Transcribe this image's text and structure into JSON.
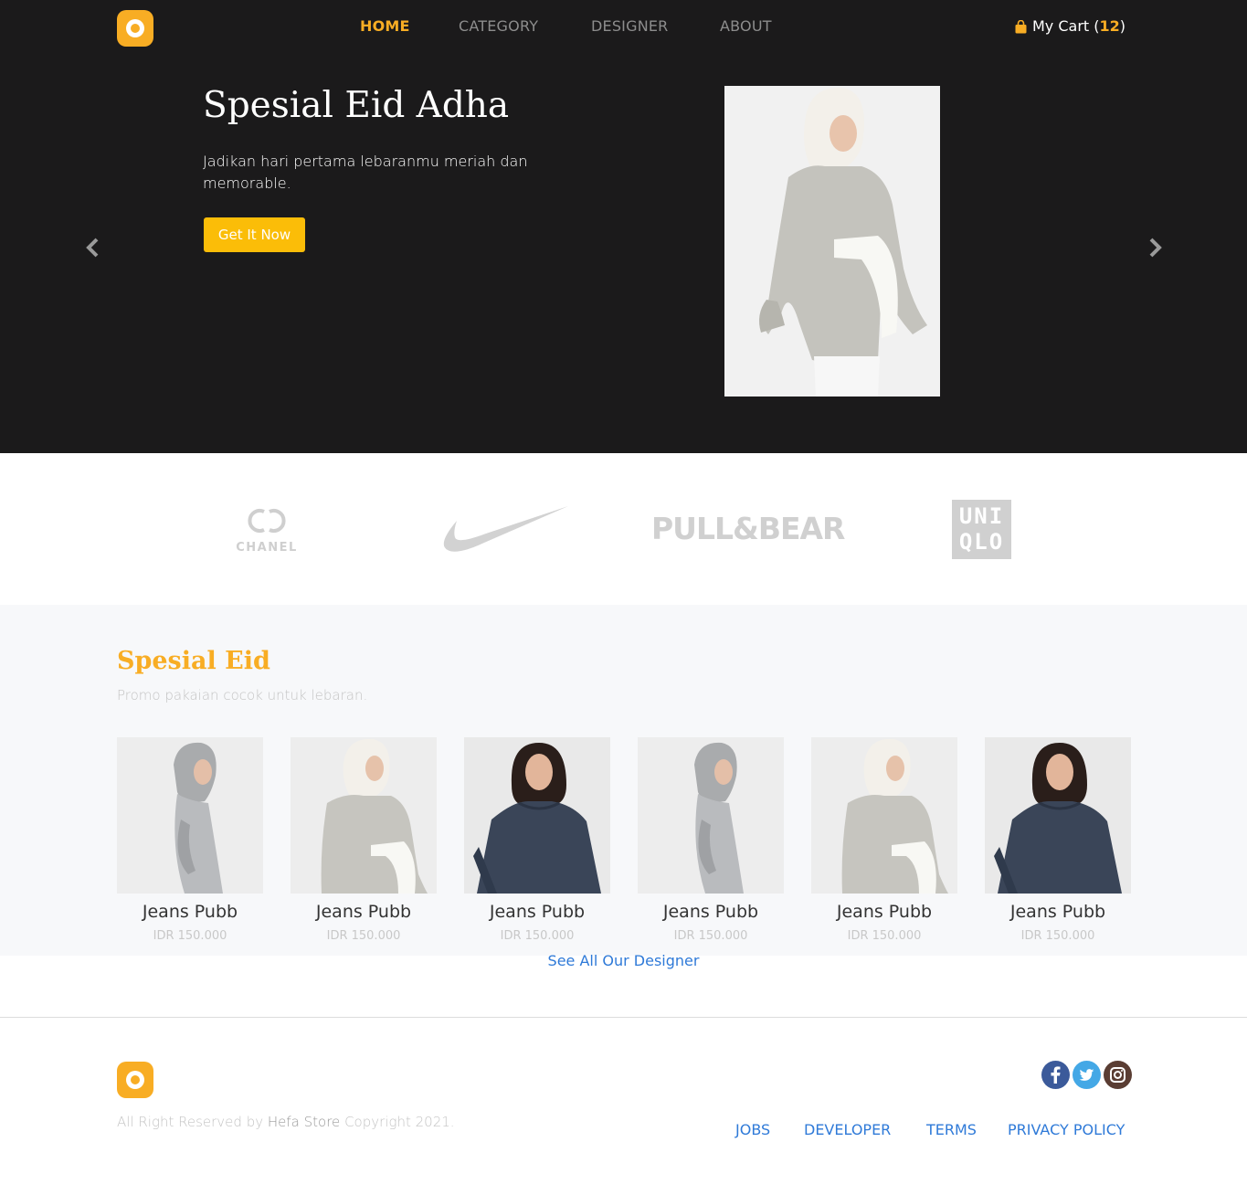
{
  "nav": {
    "items": [
      {
        "label": "HOME",
        "active": true
      },
      {
        "label": "CATEGORY",
        "active": false
      },
      {
        "label": "DESIGNER",
        "active": false
      },
      {
        "label": "ABOUT",
        "active": false
      }
    ],
    "cart": {
      "label": "My Cart",
      "count": "12",
      "icon": "shopping-bag-icon"
    }
  },
  "hero": {
    "title": "Spesial Eid Adha",
    "subtitle": "Jadikan hari pertama lebaranmu meriah dan memorable.",
    "button": "Get It Now",
    "prev_icon": "chevron-left-icon",
    "next_icon": "chevron-right-icon"
  },
  "brands": {
    "chanel": "CHANEL",
    "nike": "nike-swoosh-logo",
    "pullbear": "PULL&BEAR",
    "uniqlo": [
      "UNI",
      "QLO"
    ]
  },
  "products": {
    "title": "Spesial Eid",
    "subtitle": "Promo pakaian cocok untuk lebaran.",
    "items": [
      {
        "name": "Jeans Pubb",
        "price": "IDR 150.000",
        "style": "grey-dress"
      },
      {
        "name": "Jeans Pubb",
        "price": "IDR 150.000",
        "style": "beige-blouse"
      },
      {
        "name": "Jeans Pubb",
        "price": "IDR 150.000",
        "style": "denim-dress"
      },
      {
        "name": "Jeans Pubb",
        "price": "IDR 150.000",
        "style": "grey-dress"
      },
      {
        "name": "Jeans Pubb",
        "price": "IDR 150.000",
        "style": "beige-blouse"
      },
      {
        "name": "Jeans Pubb",
        "price": "IDR 150.000",
        "style": "denim-dress"
      }
    ],
    "see_all": "See All Our Designer"
  },
  "footer": {
    "copyright_prefix": "All Right Reserved by",
    "store_name": "Hefa Store",
    "copyright_suffix": "Copyright 2021.",
    "links": [
      "JOBS",
      "DEVELOPER",
      "TERMS",
      "PRIVACY POLICY"
    ],
    "social": [
      "facebook-icon",
      "twitter-icon",
      "instagram-icon"
    ]
  },
  "colors": {
    "accent": "#f8ad24",
    "button": "#fbbd08",
    "hero_bg": "#1b1a1b",
    "link": "#2f7ad8"
  }
}
